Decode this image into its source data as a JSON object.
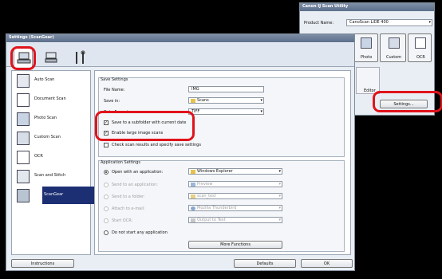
{
  "utility": {
    "title": "Canon IJ Scan Utility",
    "product_label": "Product Name:",
    "product_value": "CanoScan LiDE 400",
    "tiles": [
      "Photo",
      "Custom",
      "OCR"
    ],
    "editor_label": "Editor",
    "settings_button": "Settings..."
  },
  "settings": {
    "title": "Settings (ScanGear)",
    "tabs": [
      "scan-from-computer",
      "scan-from-panel",
      "general-settings"
    ],
    "sidebar": [
      {
        "label": "Auto Scan",
        "icon": "auto-scan-icon"
      },
      {
        "label": "Document Scan",
        "icon": "document-scan-icon"
      },
      {
        "label": "Photo Scan",
        "icon": "photo-scan-icon"
      },
      {
        "label": "Custom Scan",
        "icon": "custom-scan-icon"
      },
      {
        "label": "OCR",
        "icon": "ocr-icon"
      },
      {
        "label": "Scan and Stitch",
        "icon": "scan-and-stitch-icon"
      },
      {
        "label": "ScanGear",
        "icon": "scangear-icon"
      }
    ],
    "save_settings": {
      "heading": "Save Settings",
      "file_name_label": "File Name:",
      "file_name_value": "IMG",
      "save_in_label": "Save in:",
      "save_in_value": "Scans",
      "data_format_label": "Data Format:",
      "data_format_value": "TIFF",
      "check_subfolder": "Save to a subfolder with current date",
      "check_large": "Enable large image scans",
      "check_specify": "Check scan results and specify save settings"
    },
    "app_settings": {
      "heading": "Application Settings",
      "open_app_label": "Open with an application:",
      "open_app_value": "Windows Explorer",
      "send_app_label": "Send to an application:",
      "send_app_value": "Preview",
      "send_folder_label": "Send to a folder:",
      "send_folder_value": "scan_test",
      "attach_email_label": "Attach to e-mail:",
      "attach_email_value": "Mozilla Thunderbird",
      "start_ocr_label": "Start OCR:",
      "start_ocr_value": "Output to Text",
      "no_app_label": "Do not start any application",
      "more_functions": "More Functions"
    },
    "buttons": {
      "instructions": "Instructions",
      "defaults": "Defaults",
      "ok": "OK"
    }
  },
  "colors": {
    "highlight_red": "#e0131b",
    "selected_blue": "#1b2f72"
  }
}
